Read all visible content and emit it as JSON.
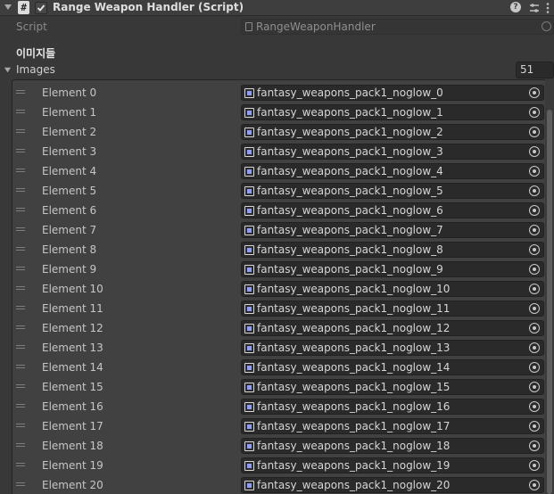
{
  "component": {
    "title": "Range Weapon Handler (Script)",
    "script_icon_glyph": "#",
    "icons": [
      "fold-arrow-icon",
      "script-icon",
      "checkbox-icon",
      "help-icon",
      "settings-icon",
      "more-icon"
    ]
  },
  "script_row": {
    "label": "Script",
    "value": "RangeWeaponHandler"
  },
  "section": {
    "header": "이미지들"
  },
  "images": {
    "label": "Images",
    "size": "51",
    "elements": [
      {
        "label": "Element 0",
        "value": "fantasy_weapons_pack1_noglow_0"
      },
      {
        "label": "Element 1",
        "value": "fantasy_weapons_pack1_noglow_1"
      },
      {
        "label": "Element 2",
        "value": "fantasy_weapons_pack1_noglow_2"
      },
      {
        "label": "Element 3",
        "value": "fantasy_weapons_pack1_noglow_3"
      },
      {
        "label": "Element 4",
        "value": "fantasy_weapons_pack1_noglow_4"
      },
      {
        "label": "Element 5",
        "value": "fantasy_weapons_pack1_noglow_5"
      },
      {
        "label": "Element 6",
        "value": "fantasy_weapons_pack1_noglow_6"
      },
      {
        "label": "Element 7",
        "value": "fantasy_weapons_pack1_noglow_7"
      },
      {
        "label": "Element 8",
        "value": "fantasy_weapons_pack1_noglow_8"
      },
      {
        "label": "Element 9",
        "value": "fantasy_weapons_pack1_noglow_9"
      },
      {
        "label": "Element 10",
        "value": "fantasy_weapons_pack1_noglow_10"
      },
      {
        "label": "Element 11",
        "value": "fantasy_weapons_pack1_noglow_11"
      },
      {
        "label": "Element 12",
        "value": "fantasy_weapons_pack1_noglow_12"
      },
      {
        "label": "Element 13",
        "value": "fantasy_weapons_pack1_noglow_13"
      },
      {
        "label": "Element 14",
        "value": "fantasy_weapons_pack1_noglow_14"
      },
      {
        "label": "Element 15",
        "value": "fantasy_weapons_pack1_noglow_15"
      },
      {
        "label": "Element 16",
        "value": "fantasy_weapons_pack1_noglow_16"
      },
      {
        "label": "Element 17",
        "value": "fantasy_weapons_pack1_noglow_17"
      },
      {
        "label": "Element 18",
        "value": "fantasy_weapons_pack1_noglow_18"
      },
      {
        "label": "Element 19",
        "value": "fantasy_weapons_pack1_noglow_19"
      },
      {
        "label": "Element 20",
        "value": "fantasy_weapons_pack1_noglow_20"
      }
    ]
  },
  "colors": {
    "background": "#383838",
    "field": "#2a2a2a",
    "sprite_accent": "#8f9cff"
  }
}
